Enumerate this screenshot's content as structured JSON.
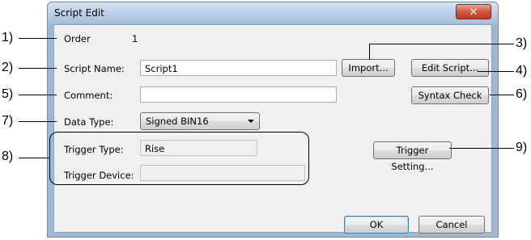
{
  "window": {
    "title": "Script Edit",
    "close_glyph": "✕"
  },
  "fields": {
    "order_label": "Order",
    "order_value": "1",
    "script_name_label": "Script Name:",
    "script_name_value": "Script1",
    "comment_label": "Comment:",
    "comment_value": "",
    "data_type_label": "Data Type:",
    "data_type_value": "Signed BIN16",
    "trigger_type_label": "Trigger Type:",
    "trigger_type_value": "Rise",
    "trigger_device_label": "Trigger Device:",
    "trigger_device_value": ""
  },
  "buttons": {
    "import": "Import...",
    "edit_script": "Edit Script...",
    "syntax_check": "Syntax Check",
    "trigger_setting": "Trigger Setting...",
    "ok": "OK",
    "cancel": "Cancel"
  },
  "callouts": {
    "c1": "1)",
    "c2": "2)",
    "c3": "3)",
    "c4": "4)",
    "c5": "5)",
    "c6": "6)",
    "c7": "7)",
    "c8": "8)",
    "c9": "9)"
  },
  "colors": {
    "titlebar": "#bcd0e6",
    "close_button": "#c23b22",
    "client_bg": "#f0f0f0"
  }
}
